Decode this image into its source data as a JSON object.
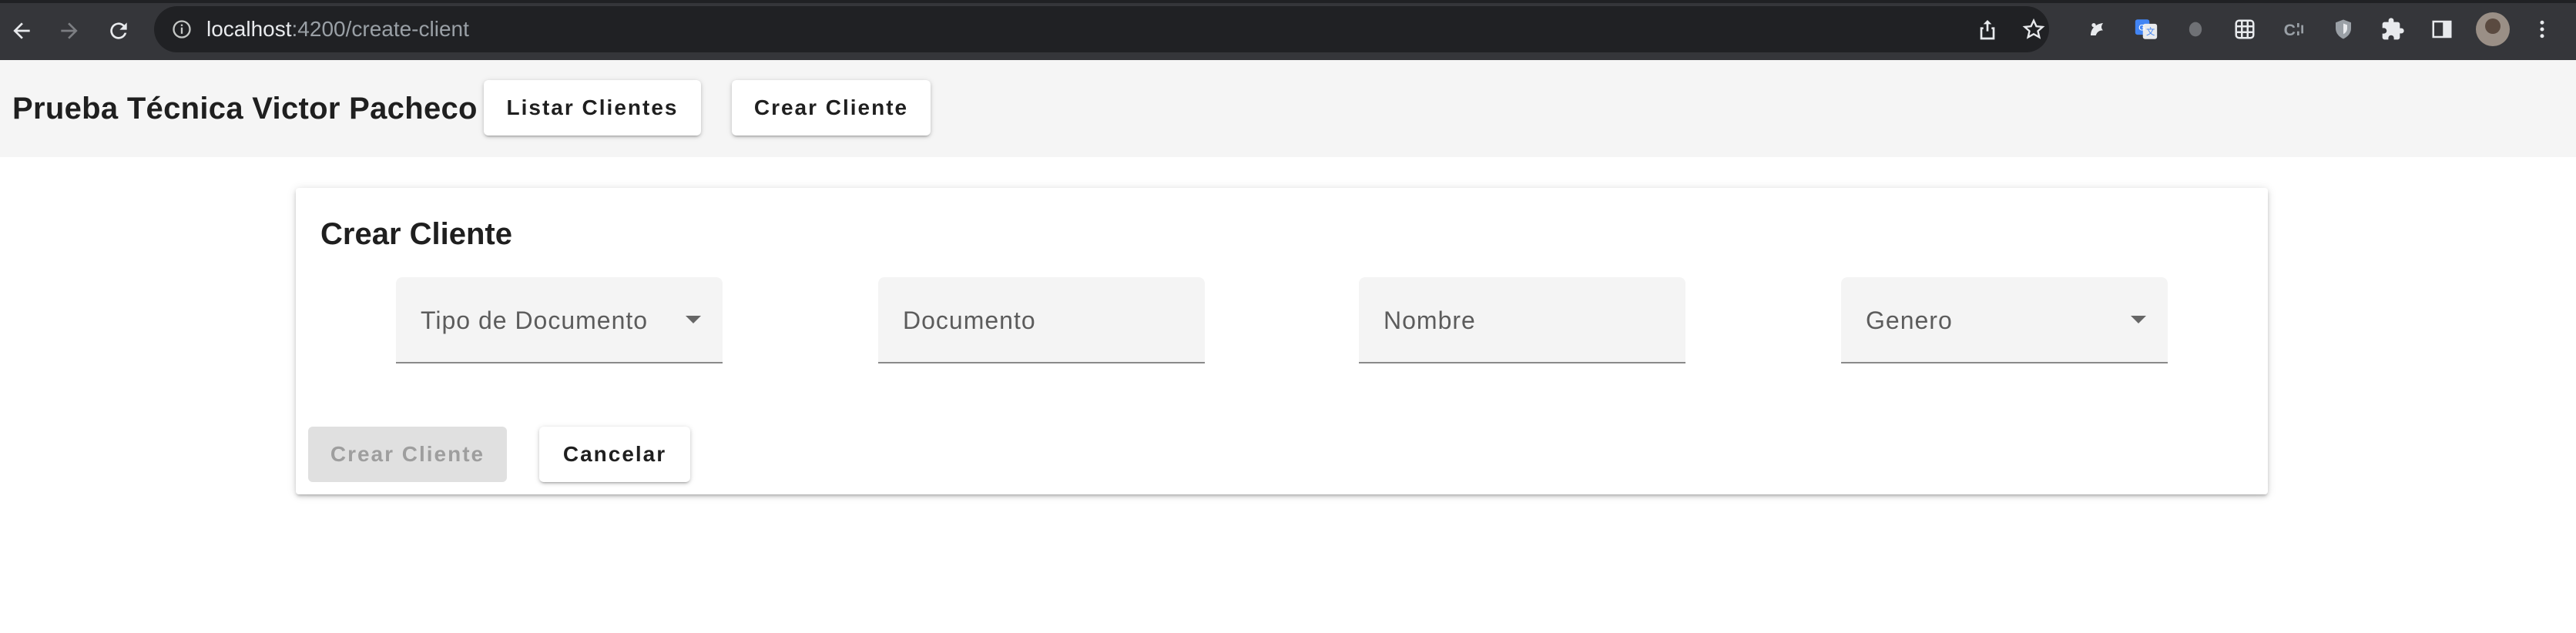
{
  "browser": {
    "url_host": "localhost",
    "url_path": ":4200/create-client",
    "extension_icons": [
      "extension-icon",
      "translate-icon",
      "extension-icon",
      "extension-icon",
      "extension-icon",
      "shield-icon",
      "puzzle-icon",
      "sidepanel-icon"
    ]
  },
  "header": {
    "title": "Prueba Técnica Victor Pacheco",
    "nav": {
      "list_clients": "Listar Clientes",
      "create_client": "Crear Cliente"
    }
  },
  "form": {
    "title": "Crear Cliente",
    "fields": {
      "document_type": "Tipo de Documento",
      "document": "Documento",
      "name": "Nombre",
      "gender": "Genero"
    },
    "actions": {
      "submit": "Crear Cliente",
      "cancel": "Cancelar"
    }
  },
  "colors": {
    "chrome_bg": "#35363a",
    "omnibox_bg": "#202124",
    "toolbar_bg": "#f5f5f5",
    "field_bg": "#f4f4f4",
    "disabled_button_bg": "#e0e0e0"
  }
}
